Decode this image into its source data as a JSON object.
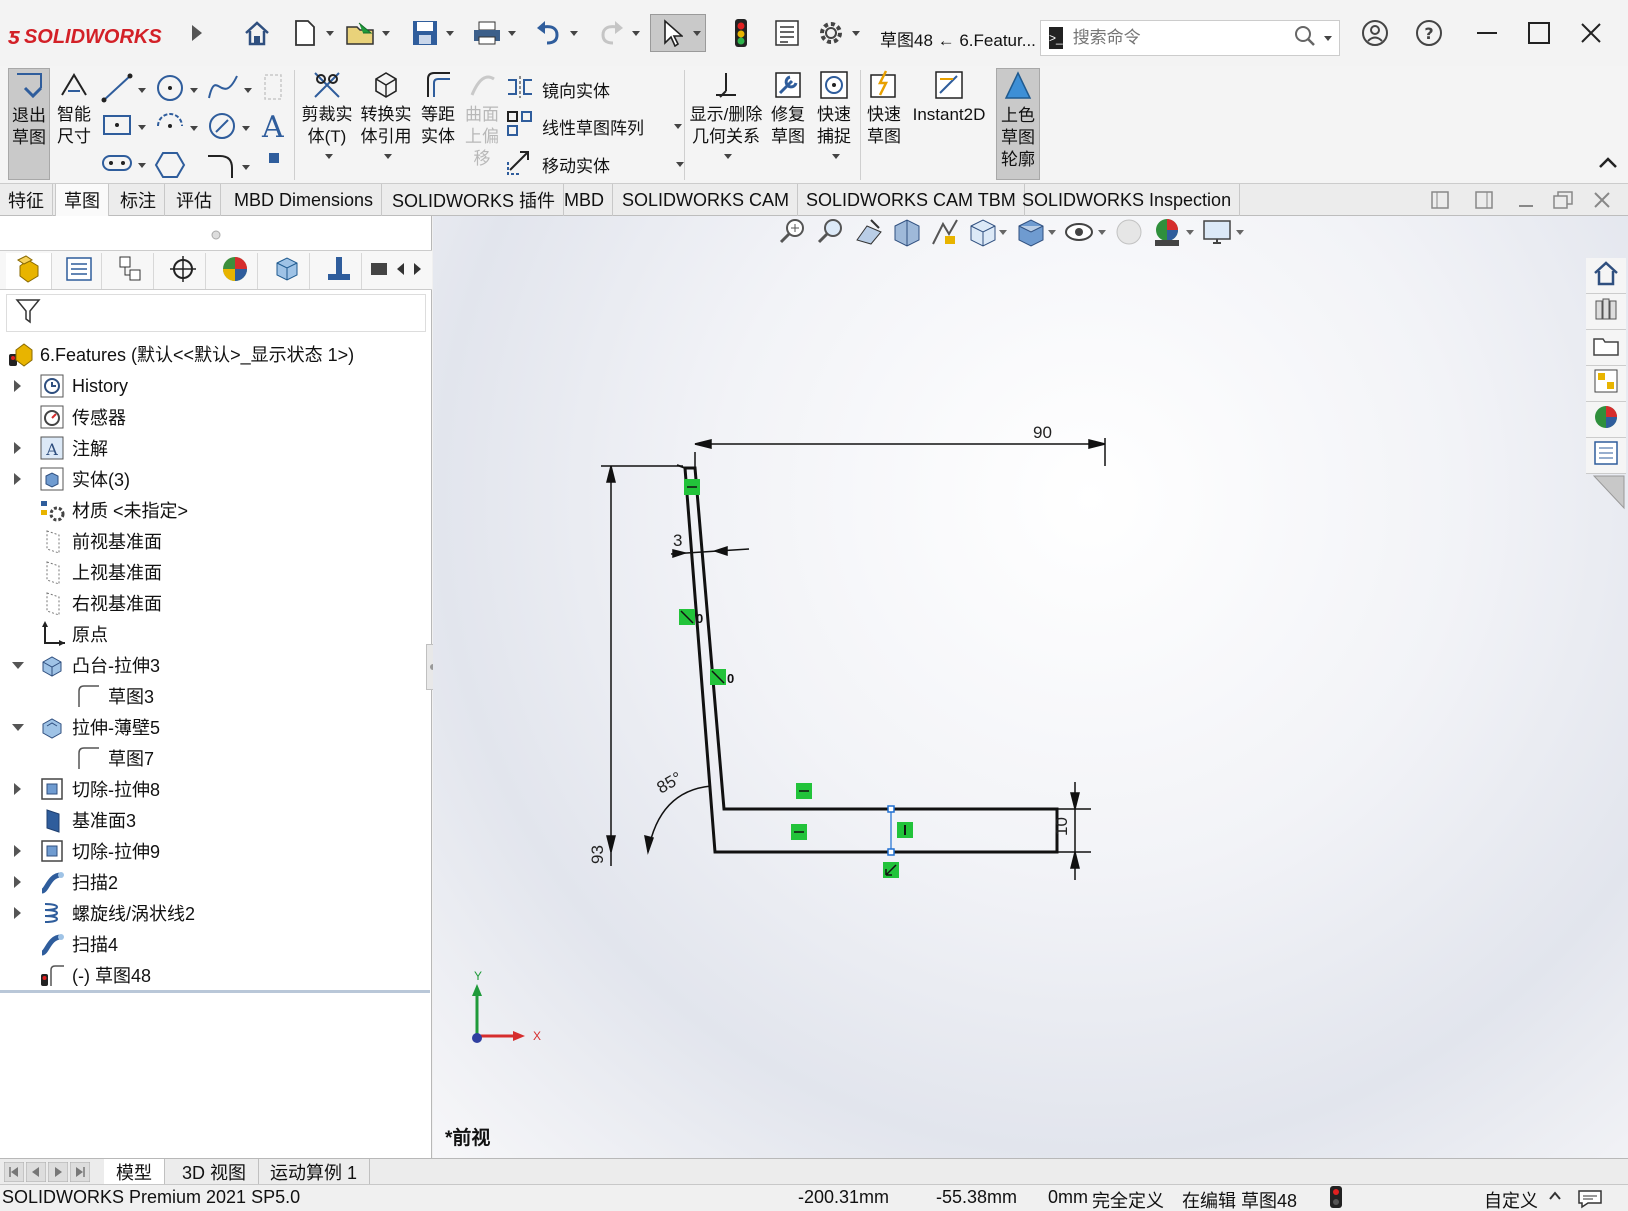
{
  "app": {
    "logo_text": "SOLIDWORKS",
    "doc_title": "草图48 ← 6.Featur...",
    "search_placeholder": "搜索命令"
  },
  "ribbon": {
    "exit_sketch": [
      "退出",
      "草图"
    ],
    "smart_dim": [
      "智能",
      "尺寸"
    ],
    "trim": [
      "剪裁实",
      "体(T)"
    ],
    "convert": [
      "转换实",
      "体引用"
    ],
    "offset": [
      "等距",
      "实体"
    ],
    "surface_offset": [
      "曲面",
      "上偏",
      "移"
    ],
    "mirror": "镜向实体",
    "linear_pattern": "线性草图阵列",
    "move": "移动实体",
    "display_relations": [
      "显示/删除",
      "几何关系"
    ],
    "repair": [
      "修复",
      "草图"
    ],
    "quick_snap": [
      "快速",
      "捕捉"
    ],
    "rapid_sketch": [
      "快速",
      "草图"
    ],
    "instant2d": "Instant2D",
    "shaded_contour": [
      "上色",
      "草图",
      "轮廓"
    ]
  },
  "tabs": [
    "特征",
    "草图",
    "标注",
    "评估",
    "MBD Dimensions",
    "SOLIDWORKS 插件",
    "MBD",
    "SOLIDWORKS CAM",
    "SOLIDWORKS CAM TBM",
    "SOLIDWORKS Inspection"
  ],
  "tree": {
    "root": "6.Features  (默认<<默认>_显示状态 1>)",
    "items": [
      {
        "label": "History",
        "icon": "history-icon",
        "expand": "closed",
        "level": 1
      },
      {
        "label": "传感器",
        "icon": "sensor-icon",
        "expand": "none",
        "level": 1
      },
      {
        "label": "注解",
        "icon": "annotation-icon",
        "expand": "closed",
        "level": 1
      },
      {
        "label": "实体(3)",
        "icon": "solid-bodies-icon",
        "expand": "closed",
        "level": 1
      },
      {
        "label": "材质 <未指定>",
        "icon": "material-icon",
        "expand": "none",
        "level": 1
      },
      {
        "label": "前视基准面",
        "icon": "plane-icon",
        "expand": "none",
        "level": 1
      },
      {
        "label": "上视基准面",
        "icon": "plane-icon",
        "expand": "none",
        "level": 1
      },
      {
        "label": "右视基准面",
        "icon": "plane-icon",
        "expand": "none",
        "level": 1
      },
      {
        "label": "原点",
        "icon": "origin-icon",
        "expand": "none",
        "level": 1
      },
      {
        "label": "凸台-拉伸3",
        "icon": "boss-extrude-icon",
        "expand": "open",
        "level": 1
      },
      {
        "label": "草图3",
        "icon": "sketch-icon",
        "expand": "none",
        "level": 2
      },
      {
        "label": "拉伸-薄壁5",
        "icon": "thin-extrude-icon",
        "expand": "open",
        "level": 1
      },
      {
        "label": "草图7",
        "icon": "sketch-icon",
        "expand": "none",
        "level": 2
      },
      {
        "label": "切除-拉伸8",
        "icon": "cut-extrude-icon",
        "expand": "closed",
        "level": 1
      },
      {
        "label": "基准面3",
        "icon": "plane3-icon",
        "expand": "none",
        "level": 1
      },
      {
        "label": "切除-拉伸9",
        "icon": "cut-extrude-icon",
        "expand": "closed",
        "level": 1
      },
      {
        "label": "扫描2",
        "icon": "sweep-icon",
        "expand": "closed",
        "level": 1
      },
      {
        "label": "螺旋线/涡状线2",
        "icon": "helix-icon",
        "expand": "closed",
        "level": 1
      },
      {
        "label": "扫描4",
        "icon": "sweep-icon",
        "expand": "none",
        "level": 1
      },
      {
        "label": "(-) 草图48",
        "icon": "sketch-active-icon",
        "expand": "none",
        "level": 1
      }
    ]
  },
  "sketch": {
    "dim_top": "90",
    "dim_thickness": "3",
    "dim_angle": "85°",
    "dim_height": "93",
    "dim_right": "10",
    "rel_zero_a": "0",
    "rel_zero_b": "0",
    "axis_x": "X",
    "axis_y": "Y"
  },
  "view_label": "*前视",
  "bottom_tabs": [
    "模型",
    "3D 视图",
    "运动算例 1"
  ],
  "status": {
    "product": "SOLIDWORKS Premium 2021 SP5.0",
    "x": "-200.31mm",
    "y": "-55.38mm",
    "z": "0mm",
    "state": "完全定义",
    "editing": "在编辑 草图48",
    "units": "自定义"
  },
  "colors": {
    "relation_green": "#22c33a",
    "sketch_black": "#111111",
    "accent_red": "#d32027"
  }
}
